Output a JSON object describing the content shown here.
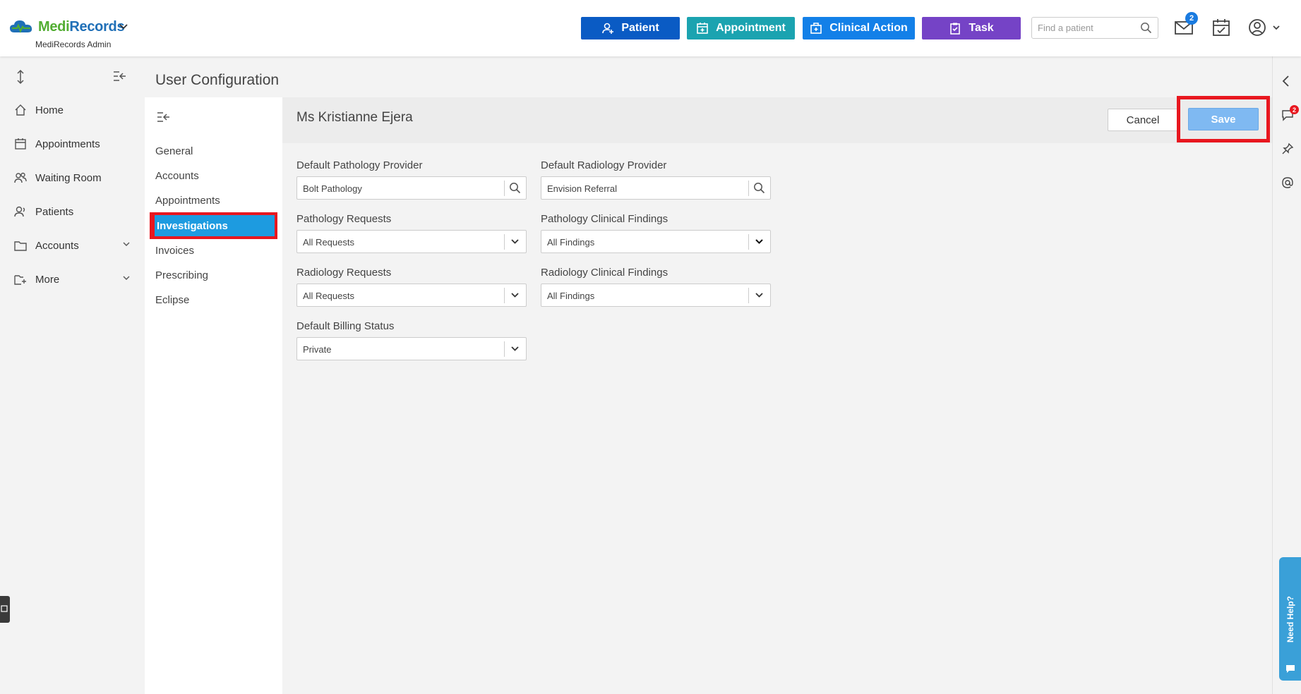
{
  "brand": {
    "name_part1": "Medi",
    "name_part2": "Records",
    "subtitle": "MediRecords Admin",
    "green": "#52ad32",
    "blue": "#1f6fb7"
  },
  "topbar": {
    "buttons": [
      {
        "label": "Patient",
        "icon": "person-add-icon",
        "color": "#0a5bc4"
      },
      {
        "label": "Appointment",
        "icon": "calendar-plus-icon",
        "color": "#1ba3b0"
      },
      {
        "label": "Clinical Action",
        "icon": "medical-bag-icon",
        "color": "#1380e8"
      },
      {
        "label": "Task",
        "icon": "clipboard-icon",
        "color": "#7543c6"
      }
    ],
    "search_placeholder": "Find a patient",
    "mail_badge": "2"
  },
  "leftnav": {
    "items": [
      {
        "label": "Home",
        "icon": "home-icon"
      },
      {
        "label": "Appointments",
        "icon": "calendar-icon"
      },
      {
        "label": "Waiting Room",
        "icon": "users-icon"
      },
      {
        "label": "Patients",
        "icon": "patients-icon"
      },
      {
        "label": "Accounts",
        "icon": "folder-icon"
      },
      {
        "label": "More",
        "icon": "more-folder-icon"
      }
    ]
  },
  "page": {
    "title": "User Configuration"
  },
  "subnav": {
    "items": [
      {
        "label": "General"
      },
      {
        "label": "Accounts"
      },
      {
        "label": "Appointments"
      },
      {
        "label": "Investigations"
      },
      {
        "label": "Invoices"
      },
      {
        "label": "Prescribing"
      },
      {
        "label": "Eclipse"
      }
    ],
    "active_color": "#1d9be0",
    "highlight_color": "#e8171f"
  },
  "content": {
    "person_name": "Ms Kristianne Ejera",
    "cancel_label": "Cancel",
    "save_label": "Save",
    "fields": [
      {
        "label": "Default Pathology Provider",
        "value": "Bolt Pathology",
        "kind": "search"
      },
      {
        "label": "Default Radiology Provider",
        "value": "Envision Referral",
        "kind": "search"
      },
      {
        "label": "Pathology Requests",
        "value": "All Requests",
        "kind": "select"
      },
      {
        "label": "Pathology Clinical Findings",
        "value": "All Findings",
        "kind": "select"
      },
      {
        "label": "Radiology Requests",
        "value": "All Requests",
        "kind": "select"
      },
      {
        "label": "Radiology Clinical Findings",
        "value": "All Findings",
        "kind": "select"
      },
      {
        "label": "Default Billing Status",
        "value": "Private",
        "kind": "select"
      }
    ]
  },
  "rightrail": {
    "chat_badge": "2",
    "help_label": "Need Help?"
  }
}
